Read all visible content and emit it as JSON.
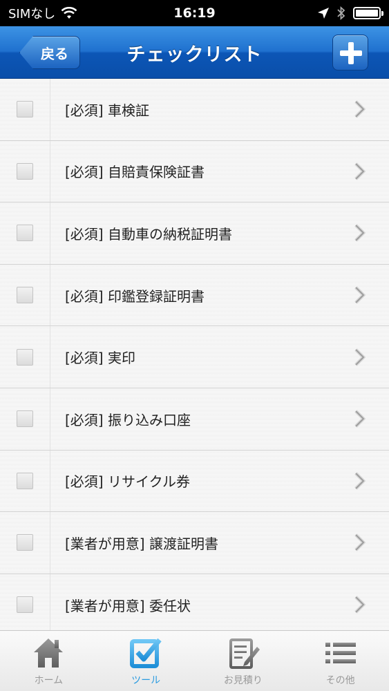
{
  "status_bar": {
    "carrier": "SIMなし",
    "time": "16:19"
  },
  "nav": {
    "title": "チェックリスト",
    "back_label": "戻る"
  },
  "checklist": {
    "items": [
      {
        "label": "[必須] 車検証",
        "checked": false
      },
      {
        "label": "[必須] 自賠責保険証書",
        "checked": false
      },
      {
        "label": "[必須] 自動車の納税証明書",
        "checked": false
      },
      {
        "label": "[必須] 印鑑登録証明書",
        "checked": false
      },
      {
        "label": "[必須] 実印",
        "checked": false
      },
      {
        "label": "[必須] 振り込み口座",
        "checked": false
      },
      {
        "label": "[必須] リサイクル券",
        "checked": false
      },
      {
        "label": "[業者が用意] 譲渡証明書",
        "checked": false
      },
      {
        "label": "[業者が用意] 委任状",
        "checked": false
      }
    ]
  },
  "tabs": [
    {
      "label": "ホーム",
      "icon": "home-icon",
      "active": false
    },
    {
      "label": "ツール",
      "icon": "checkbox-icon",
      "active": true
    },
    {
      "label": "お見積り",
      "icon": "estimate-icon",
      "active": false
    },
    {
      "label": "その他",
      "icon": "list-icon",
      "active": false
    }
  ],
  "colors": {
    "nav_blue": "#1f71cf",
    "active_tab": "#2a9be0",
    "inactive_tab": "#9a9a9a"
  }
}
